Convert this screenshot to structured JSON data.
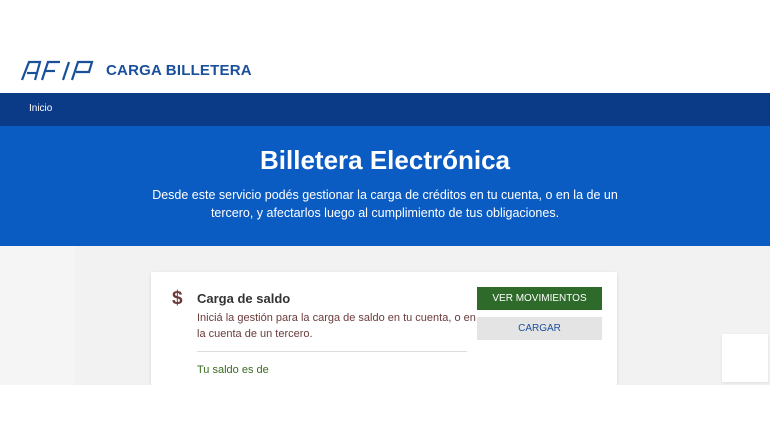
{
  "header": {
    "logo_text": "AFIP",
    "app_title": "CARGA BILLETERA"
  },
  "nav": {
    "items": [
      {
        "label": "Inicio"
      }
    ]
  },
  "hero": {
    "title": "Billetera Electrónica",
    "description": "Desde este servicio podés gestionar la carga de créditos en tu cuenta, o en la de un tercero, y afectarlos luego al cumplimiento de tus obligaciones."
  },
  "card": {
    "icon": "dollar-icon",
    "icon_glyph": "$",
    "title": "Carga de saldo",
    "description": "Iniciá la gestión para la carga de saldo en tu cuenta, o en la cuenta de un tercero.",
    "balance_label": "Tu saldo es de",
    "primary_button": "VER MOVIMIENTOS",
    "secondary_button": "CARGAR"
  },
  "colors": {
    "brand_blue": "#1a4f9c",
    "nav_blue": "#0b3a86",
    "hero_blue": "#0b5cc2",
    "primary_green": "#2e6b2a"
  }
}
